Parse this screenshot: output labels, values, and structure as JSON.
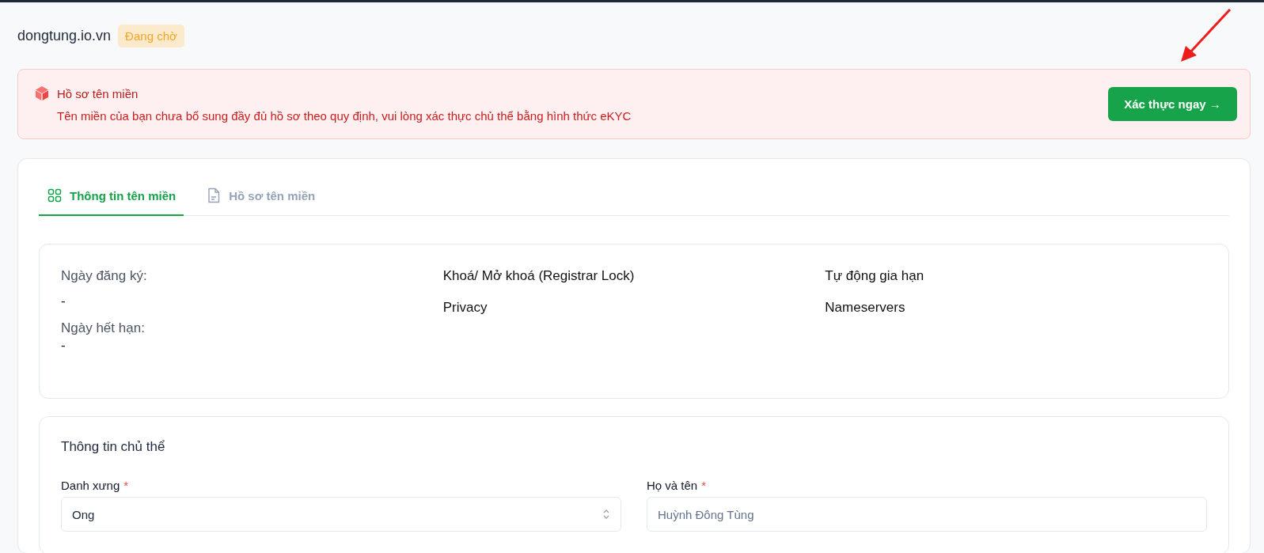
{
  "header": {
    "domain": "dongtung.io.vn",
    "status": "Đang chờ"
  },
  "alert": {
    "title": "Hồ sơ tên miền",
    "message": "Tên miền của bạn chưa bổ sung đầy đủ hồ sơ theo quy định, vui lòng xác thực chủ thể bằng hình thức eKYC",
    "button": "Xác thực ngay →"
  },
  "annotations": [
    {
      "kind": "arrow"
    }
  ],
  "tabs": [
    {
      "label": "Thông tin tên miền",
      "selected": true
    },
    {
      "label": "Hồ sơ tên miền",
      "selected": false
    }
  ],
  "domain_info": {
    "columns": [
      [
        {
          "label": "Ngày đăng ký:",
          "value": "-"
        },
        {
          "label": "Ngày hết hạn:",
          "value": "-"
        }
      ],
      [
        {
          "label": "Khoá/ Mở khoá (Registrar Lock)"
        },
        {
          "label": "Privacy"
        }
      ],
      [
        {
          "label": "Tự động gia hạn"
        },
        {
          "label": "Nameservers"
        }
      ]
    ]
  },
  "owner": {
    "title": "Thông tin chủ thể",
    "fields": [
      {
        "kind": "select",
        "label": "Danh xưng",
        "required_mark": "*",
        "value": "Ong"
      },
      {
        "kind": "text",
        "label": "Họ và tên",
        "required_mark": "*",
        "value": "Huỳnh Đông Tùng"
      }
    ]
  }
}
